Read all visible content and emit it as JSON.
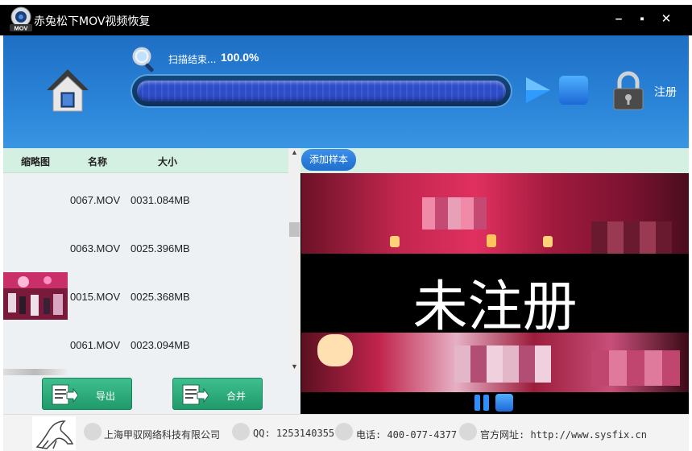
{
  "app": {
    "title": "赤兔松下MOV视频恢复",
    "logo_badge": "MOV"
  },
  "window_controls": {
    "minimize": "–",
    "maximize": "▪",
    "close": "✕"
  },
  "scan": {
    "status_text": "扫描结束...",
    "percent_text": "100.0%",
    "progress": 1.0
  },
  "register": {
    "label": "注册"
  },
  "file_list": {
    "columns": [
      "缩略图",
      "名称",
      "大小"
    ],
    "rows": [
      {
        "name": "0067.MOV",
        "size": "0031.084MB",
        "has_thumbnail": false
      },
      {
        "name": "0063.MOV",
        "size": "0025.396MB",
        "has_thumbnail": false
      },
      {
        "name": "0015.MOV",
        "size": "0025.368MB",
        "has_thumbnail": true
      },
      {
        "name": "0061.MOV",
        "size": "0023.094MB",
        "has_thumbnail": false
      }
    ]
  },
  "actions": {
    "export_label": "导出",
    "merge_label": "合并"
  },
  "preview": {
    "add_sample_label": "添加样本",
    "watermark_text": "未注册"
  },
  "footer": {
    "company": "上海甲驭网络科技有限公司",
    "qq": "QQ: 1253140355",
    "phone": "电话: 400-077-4377",
    "website": "官方网址: http://www.sysfix.cn"
  },
  "colors": {
    "header_blue": "#2a84d8",
    "list_header_green": "#d4f0e3",
    "button_green": "#2aa878",
    "progress_blue": "#2d4cc6"
  },
  "icons": [
    "home-icon",
    "magnifier-icon",
    "play-icon",
    "stop-icon",
    "lock-icon",
    "export-icon",
    "merge-icon",
    "pause-icon",
    "building-icon",
    "qq-icon",
    "phone-icon",
    "globe-icon"
  ]
}
